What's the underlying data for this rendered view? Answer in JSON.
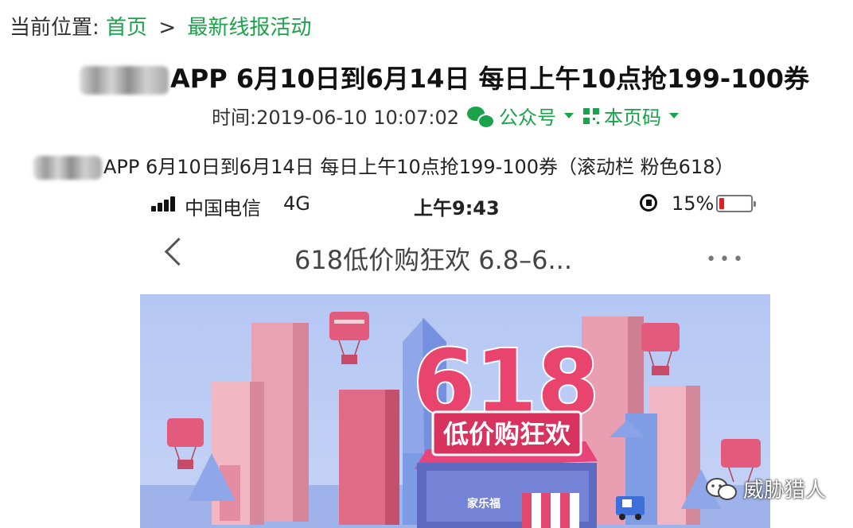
{
  "breadcrumb": {
    "prefix": "当前位置:",
    "home": "首页",
    "separator": ">",
    "current": "最新线报活动"
  },
  "article": {
    "title": "APP 6月10日到6月14日 每日上午10点抢199-100券",
    "time_label": "时间:2019-06-10 10:07:02",
    "wechat_label": "公众号",
    "qr_label": "本页码",
    "subtitle": "APP 6月10日到6月14日 每日上午10点抢199-100券（滚动栏 粉色618）"
  },
  "phone": {
    "carrier": "中国电信",
    "network": "4G",
    "time": "上午9:43",
    "battery_percent_label": "15%",
    "battery_level": 0.15,
    "nav_title": "618低价购狂欢 6.8–6...",
    "more_label": "•••",
    "banner": {
      "big_number": "618",
      "slogan": "低价购狂欢",
      "store_label": "家乐福"
    }
  },
  "watermark": {
    "text": "威胁猎人"
  },
  "colors": {
    "link_green": "#1aa34a",
    "banner_sky": "#b4c7f3",
    "banner_pink": "#e8446e",
    "battery_red": "#e02020"
  }
}
